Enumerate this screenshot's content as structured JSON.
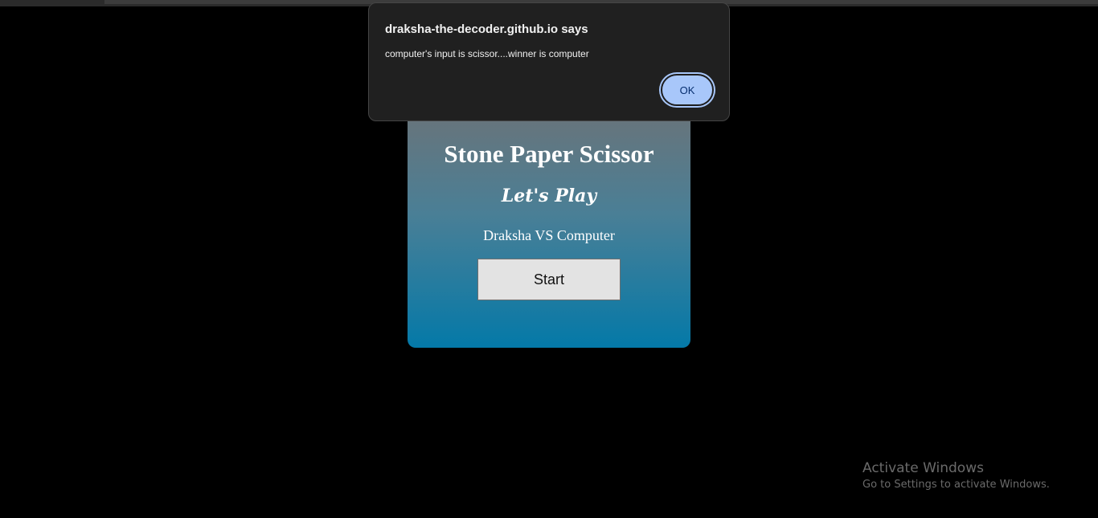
{
  "game": {
    "title": "Stone Paper Scissor",
    "subtitle": "Let's Play",
    "matchup": "Draksha VS Computer",
    "start_label": "Start"
  },
  "alert": {
    "origin": "draksha-the-decoder.github.io says",
    "message": "computer's input is scissor....winner is computer",
    "ok_label": "OK"
  },
  "watermark": {
    "title": "Activate Windows",
    "subtitle": "Go to Settings to activate Windows."
  },
  "colors": {
    "page_background": "#000000",
    "card_gradient_top": "#6b7378",
    "card_gradient_bottom": "#0479a8",
    "dialog_background": "#202020",
    "ok_button": "#a8c7fa"
  }
}
